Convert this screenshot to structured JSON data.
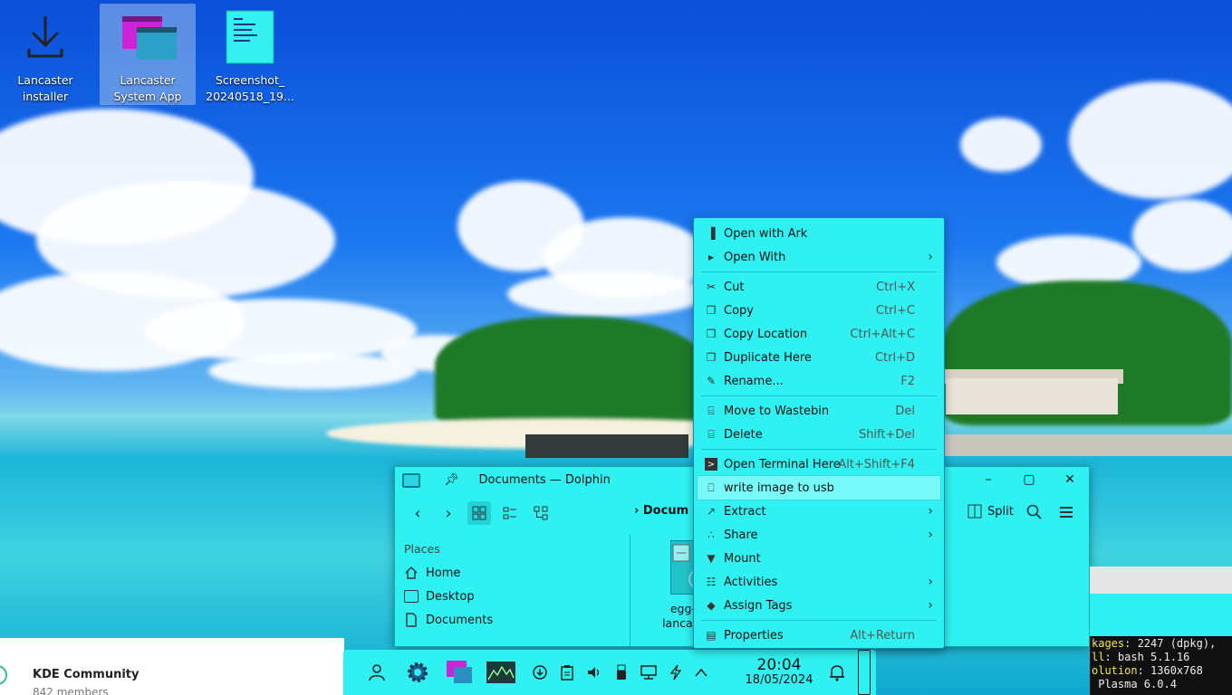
{
  "desktop": {
    "icons": [
      {
        "label_1": "Lancaster",
        "label_2": "installer",
        "icon": "download-icon"
      },
      {
        "label_1": "Lancaster",
        "label_2": "System App",
        "icon": "windows-app-icon"
      },
      {
        "label_1": "Screenshot_",
        "label_2": "20240518_19...",
        "icon": "image-file-icon"
      }
    ]
  },
  "dolphin": {
    "title": "Documents — Dolphin",
    "breadcrumb": "Docum",
    "split_label": "Split",
    "places_header": "Places",
    "places": [
      "Home",
      "Desktop",
      "Documents"
    ],
    "file": {
      "line1": "egg-of",
      "line2": "lancaster"
    }
  },
  "context_menu": {
    "items": [
      {
        "label": "Open with Ark",
        "shortcut": "",
        "icon": "ark-icon",
        "submenu": false
      },
      {
        "label": "Open With",
        "shortcut": "",
        "icon": "open-with-icon",
        "submenu": true
      },
      {
        "label": "Cut",
        "shortcut": "Ctrl+X",
        "icon": "scissors-icon",
        "submenu": false
      },
      {
        "label": "Copy",
        "shortcut": "Ctrl+C",
        "icon": "copy-icon",
        "submenu": false
      },
      {
        "label": "Copy Location",
        "shortcut": "Ctrl+Alt+C",
        "icon": "copy-location-icon",
        "submenu": false
      },
      {
        "label": "Duplicate Here",
        "shortcut": "Ctrl+D",
        "icon": "duplicate-icon",
        "submenu": false
      },
      {
        "label": "Rename...",
        "shortcut": "F2",
        "icon": "pencil-icon",
        "submenu": false
      },
      {
        "label": "Move to Wastebin",
        "shortcut": "Del",
        "icon": "trash-icon",
        "submenu": false
      },
      {
        "label": "Delete",
        "shortcut": "Shift+Del",
        "icon": "delete-icon",
        "submenu": false
      },
      {
        "label": "Open Terminal Here",
        "shortcut": "Alt+Shift+F4",
        "icon": "terminal-icon",
        "submenu": false
      },
      {
        "label": "write image to usb",
        "shortcut": "",
        "icon": "usb-icon",
        "submenu": false,
        "highlighted": true
      },
      {
        "label": "Extract",
        "shortcut": "",
        "icon": "extract-icon",
        "submenu": true
      },
      {
        "label": "Share",
        "shortcut": "",
        "icon": "share-icon",
        "submenu": true
      },
      {
        "label": "Mount",
        "shortcut": "",
        "icon": "mount-icon",
        "submenu": false
      },
      {
        "label": "Activities",
        "shortcut": "",
        "icon": "activities-icon",
        "submenu": true
      },
      {
        "label": "Assign Tags",
        "shortcut": "",
        "icon": "tag-icon",
        "submenu": true
      },
      {
        "label": "Properties",
        "shortcut": "Alt+Return",
        "icon": "properties-icon",
        "submenu": false
      }
    ]
  },
  "terminal": {
    "lines": [
      {
        "key": "kages",
        "value": ": 2247 (dpkg),"
      },
      {
        "key": "ll",
        "value": ": bash 5.1.16"
      },
      {
        "key": "olution",
        "value": ": 1360x768"
      },
      {
        "key": "",
        "value": " Plasma 6.0.4"
      }
    ]
  },
  "kde_community": {
    "name": "KDE Community",
    "members": "842 members"
  },
  "panel": {
    "time": "20:04",
    "date": "18/05/2024"
  },
  "colors": {
    "theme_cyan": "#2ff1f1",
    "menu_border": "#18b"
  }
}
